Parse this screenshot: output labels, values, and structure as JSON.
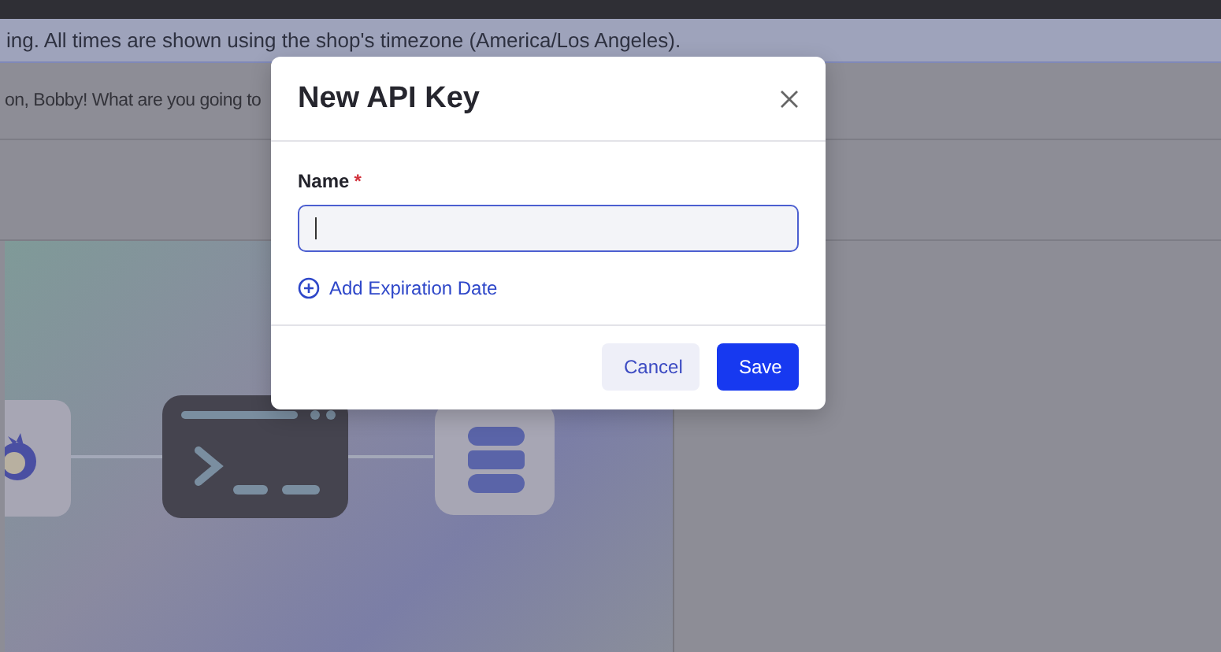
{
  "banner": {
    "text": "ing. All times are shown using the shop's timezone (America/Los Angeles)."
  },
  "greeting": {
    "text": "on, Bobby! What are you going to"
  },
  "dialog": {
    "title": "New API Key",
    "field": {
      "label": "Name",
      "required_mark": "*",
      "focused": true
    },
    "add_link": "Add Expiration Date",
    "buttons": [
      {
        "label": "Cancel",
        "kind": "secondary"
      },
      {
        "label": "Save",
        "kind": "primary"
      }
    ]
  }
}
